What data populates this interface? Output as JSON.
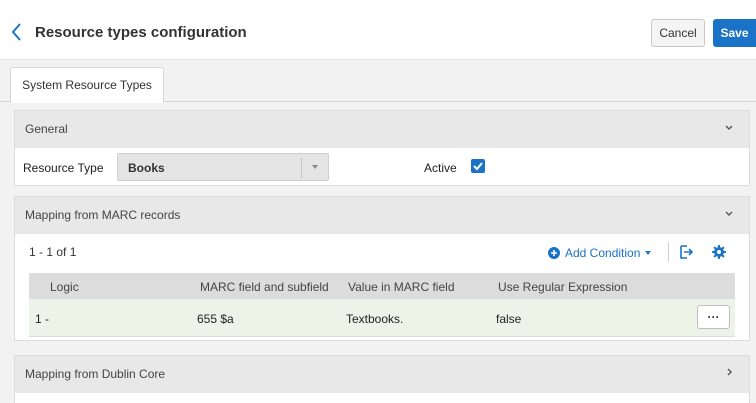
{
  "header": {
    "title": "Resource types configuration",
    "cancel_label": "Cancel",
    "save_label": "Save"
  },
  "tabs": [
    {
      "label": "System Resource Types",
      "active": true
    }
  ],
  "general": {
    "title": "General",
    "resource_type_label": "Resource Type",
    "resource_type_value": "Books",
    "active_label": "Active",
    "active_checked": true
  },
  "marc": {
    "title": "Mapping from MARC records",
    "count": "1 - 1 of 1",
    "add_condition_label": "Add Condition",
    "columns": [
      "Logic",
      "MARC field and subfield",
      "Value in MARC field",
      "Use Regular Expression"
    ],
    "rows": [
      {
        "logic": "1 -",
        "marc_field": "655 $a",
        "value": "Textbooks.",
        "regex": "false",
        "actions_label": "···"
      }
    ]
  },
  "dublin_core": {
    "title": "Mapping from Dublin Core"
  },
  "colors": {
    "accent": "#1a73c7",
    "panel_header": "#e8e8e8",
    "row_highlight": "#eef3e8"
  }
}
